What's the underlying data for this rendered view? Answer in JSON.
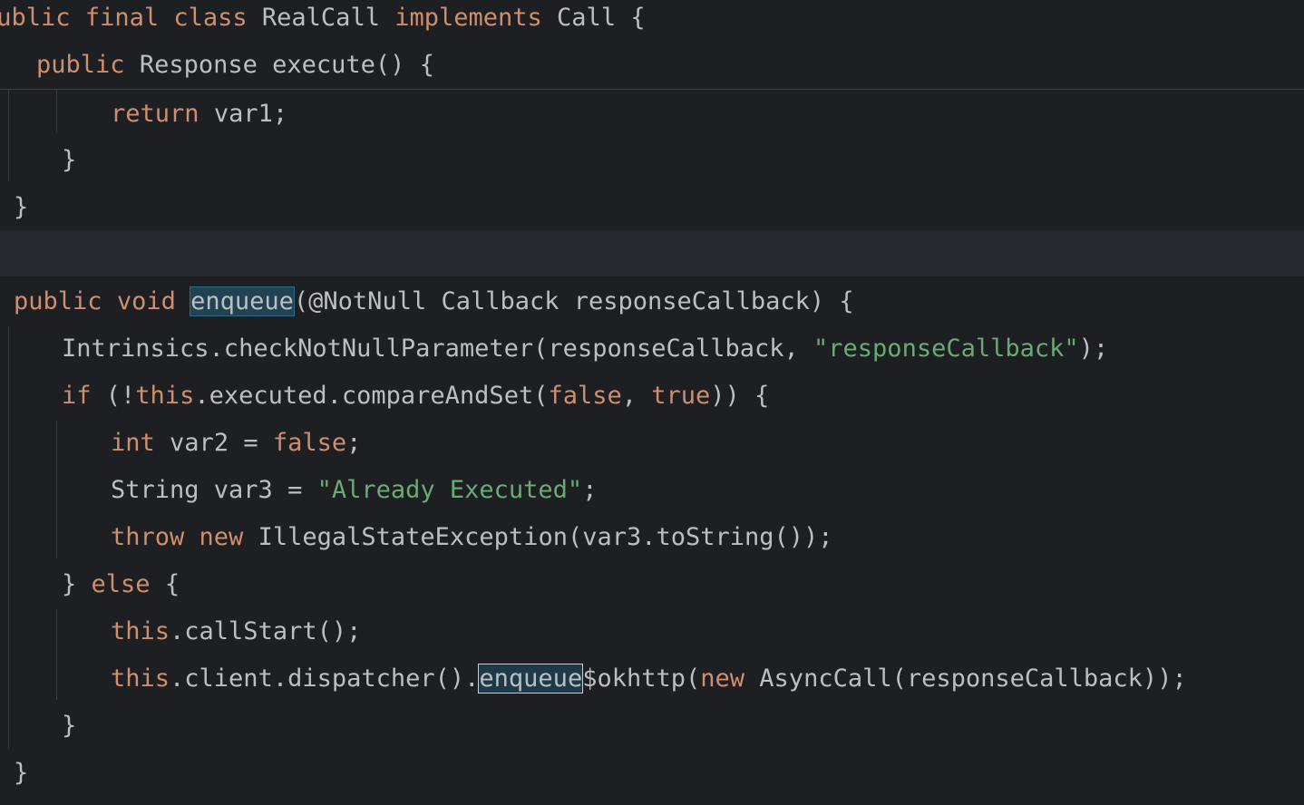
{
  "sticky_header": {
    "line1": {
      "indent": "",
      "k_public": "public",
      "k_final": "final",
      "k_class": "class",
      "class_name": "RealCall",
      "k_implements": "implements",
      "iface": "Call",
      "brace": "{"
    },
    "line2": {
      "k_public": "public",
      "ret_type": "Response",
      "method": "execute()",
      "brace": "{"
    }
  },
  "code": {
    "return_kw": "return",
    "return_rest": "var1;",
    "close1": "}",
    "close2": "}",
    "enq_sig": {
      "k_public": "public",
      "k_void": "void",
      "name": "enqueue",
      "rest": "(@NotNull Callback responseCallback) {"
    },
    "check_line": {
      "pre": "Intrinsics.checkNotNullParameter(responseCallback, ",
      "str": "\"responseCallback\"",
      "post": ");"
    },
    "if_line": {
      "k_if": "if",
      "a": "(!",
      "k_this": "this",
      "b": ".executed.compareAndSet(",
      "k_false": "false",
      "c": ", ",
      "k_true": "true",
      "d": ")) {"
    },
    "int_line": {
      "k_int": "int",
      "a": "var2 = ",
      "k_false": "false",
      "b": ";"
    },
    "string_line": {
      "a": "String var3 = ",
      "str": "\"Already Executed\"",
      "b": ";"
    },
    "throw_line": {
      "k_throw": "throw",
      "k_new": "new",
      "rest": "IllegalStateException(var3.toString());"
    },
    "else_line": {
      "a": "} ",
      "k_else": "else",
      "b": "{"
    },
    "callstart_line": {
      "k_this": "this",
      "rest": ".callStart();"
    },
    "dispatch_line": {
      "k_this": "this",
      "a": ".client.dispatcher().",
      "name": "enqueue",
      "b": "$okhttp(",
      "k_new": "new",
      "c": "AsyncCall(responseCallback));"
    },
    "close3": "}",
    "close4": "}"
  },
  "colors": {
    "background": "#1e1f22",
    "keyword": "#cf8e6d",
    "string": "#6aab73",
    "text": "#bcbec4",
    "identifier_highlight": "#214253"
  }
}
